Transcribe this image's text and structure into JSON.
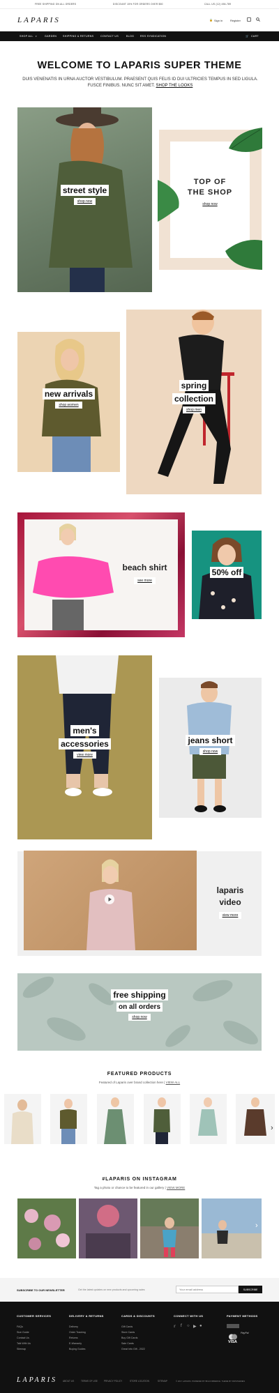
{
  "topbar": {
    "shipping": "Free shipping on all orders",
    "discount": "Discount 15% for orders over $50",
    "phone": "Call us (12) 456-789"
  },
  "header": {
    "logo": "LAPARIS",
    "sign_in": "Sign in",
    "register": "Register",
    "user_icon": "user-icon",
    "search_icon": "search-icon"
  },
  "nav": {
    "items": [
      "Shop All",
      "Garden",
      "Shipping & Returns",
      "Contact Us",
      "Blog",
      "RSS Syndication"
    ],
    "cart": "Cart"
  },
  "welcome": {
    "title": "WELCOME TO LAPARIS SUPER THEME",
    "text": "DUIS VENENATIS IN URNA AUCTOR VESTIBULUM. PRAESENT QUIS FELIS ID DUI ULTRICIES TEMPUS IN SED LIGULA. FUSCE FINIBUS. NUNC SIT AMET.",
    "link": "SHOP THE LOOKS"
  },
  "tiles": {
    "street_style": {
      "label": "street style",
      "button": "shop now"
    },
    "top_shop": {
      "line1": "TOP OF",
      "line2": "THE SHOP",
      "button": "shop now"
    },
    "new_arrivals": {
      "label": "new arrivals",
      "button": "shop women"
    },
    "spring": {
      "line1": "spring",
      "line2": "collection",
      "button": "shop men"
    },
    "beach": {
      "label": "beach shirt",
      "button": "see more"
    },
    "off": {
      "label": "50% off"
    },
    "mens": {
      "line1": "men's",
      "line2": "accessories",
      "button": "view more"
    },
    "jeans": {
      "label": "jeans short",
      "button": "shop now"
    },
    "video": {
      "line1": "laparis",
      "line2": "video",
      "button": "view more"
    },
    "shipping": {
      "line1": "free shipping",
      "line2": "on all orders",
      "button": "shop now"
    }
  },
  "featured": {
    "title": "FEATURED PRODUCTS",
    "subtitle": "Featured of Laparis over brand collection here |",
    "link": "VIEW ALL"
  },
  "instagram": {
    "title": "#LAPARIS ON INSTAGRAM",
    "subtitle": "Tag a photo or chance to be featured in our gallery |",
    "link": "VIEW MORE"
  },
  "newsletter": {
    "title": "SUBSCRIBE TO OUR NEWSLETTER",
    "text": "Get the latest updates on new products and upcoming sales",
    "placeholder": "Your email address",
    "button": "SUBSCRIBE"
  },
  "footer": {
    "columns": [
      {
        "title": "Customer Services",
        "items": [
          "FAQs",
          "Size Guide",
          "Contact Us",
          "Talk With Us",
          "Sitemap"
        ]
      },
      {
        "title": "Delivery & Returns",
        "items": [
          "Delivery",
          "Order Tracking",
          "Returns",
          "E-Warranty",
          "Buying Guides"
        ]
      },
      {
        "title": "Cards & Discounts",
        "items": [
          "Gift Cards",
          "Store Cards",
          "Buy Gift Cards",
          "Sale Cards",
          "Great Info Gift - 2022"
        ]
      },
      {
        "title": "Connect With Us",
        "items": []
      },
      {
        "title": "Payment Methods",
        "items": [
          "PayPal",
          "VISA"
        ]
      }
    ],
    "logo": "LAPARIS",
    "links": [
      "About Us",
      "Terms of Use",
      "Privacy Policy",
      "Store Location",
      "Sitemap"
    ],
    "copyright": "© 2017 LAPARIS. POWERED BY BIGCOMMERCE. THEME BY PAPATHEMES"
  }
}
